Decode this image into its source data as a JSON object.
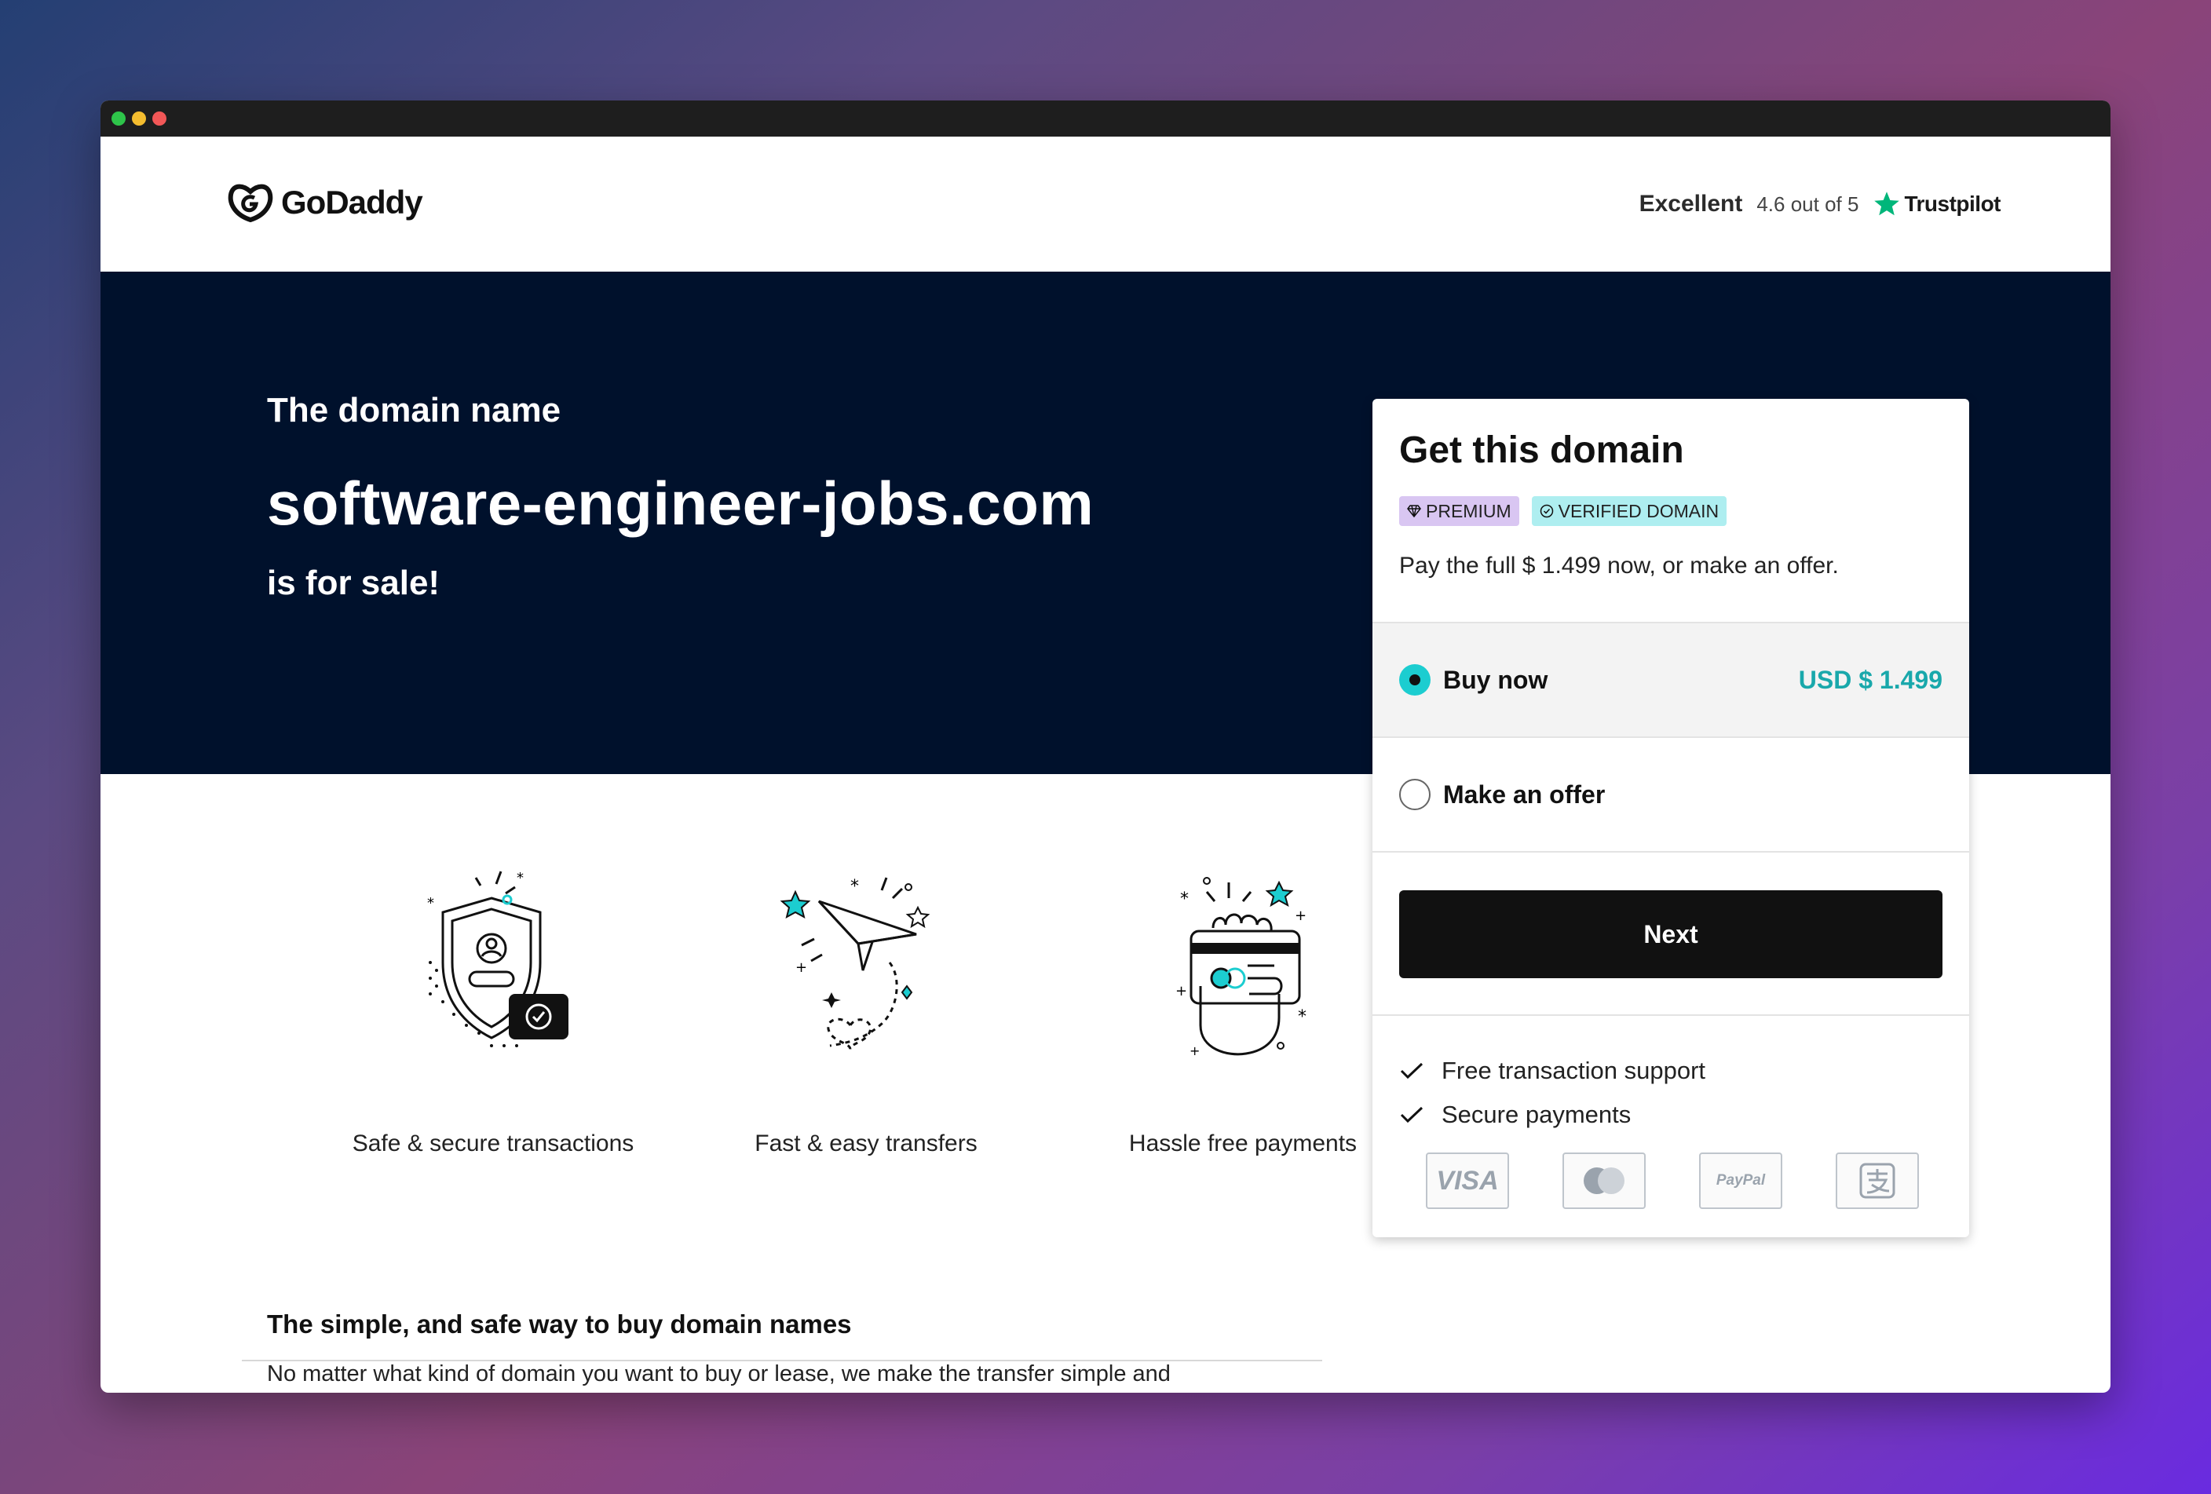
{
  "header": {
    "logo_text": "GoDaddy",
    "rating_label": "Excellent",
    "rating_score": "4.6 out of 5",
    "trustpilot": "Trustpilot"
  },
  "hero": {
    "intro": "The domain name",
    "domain": "software-engineer-jobs.com",
    "for_sale": "is for sale!"
  },
  "features": [
    {
      "label": "Safe & secure transactions",
      "icon": "shield-icon"
    },
    {
      "label": "Fast & easy transfers",
      "icon": "paper-plane-icon"
    },
    {
      "label": "Hassle free payments",
      "icon": "credit-card-hand-icon"
    }
  ],
  "bottom": {
    "heading": "The simple, and safe way to buy domain names",
    "text": "No matter what kind of domain you want to buy or lease, we make the transfer simple and"
  },
  "card": {
    "title": "Get this domain",
    "badge_premium": "PREMIUM",
    "badge_verified": "VERIFIED DOMAIN",
    "pay_text": "Pay the full $ 1.499 now, or make an offer.",
    "option_buy": "Buy now",
    "option_buy_price": "USD $ 1.499",
    "option_offer": "Make an offer",
    "next_label": "Next",
    "perks": [
      "Free transaction support",
      "Secure payments"
    ],
    "payment_methods": [
      "VISA",
      "Mastercard",
      "PayPal",
      "Alipay"
    ],
    "selected_option": "Buy now"
  },
  "colors": {
    "hero_bg": "#00112c",
    "accent": "#1ccdd0",
    "price": "#19a8ab",
    "premium_badge": "#d9c6f2",
    "verified_badge": "#aeeef0",
    "trustpilot_star": "#00b67a"
  }
}
